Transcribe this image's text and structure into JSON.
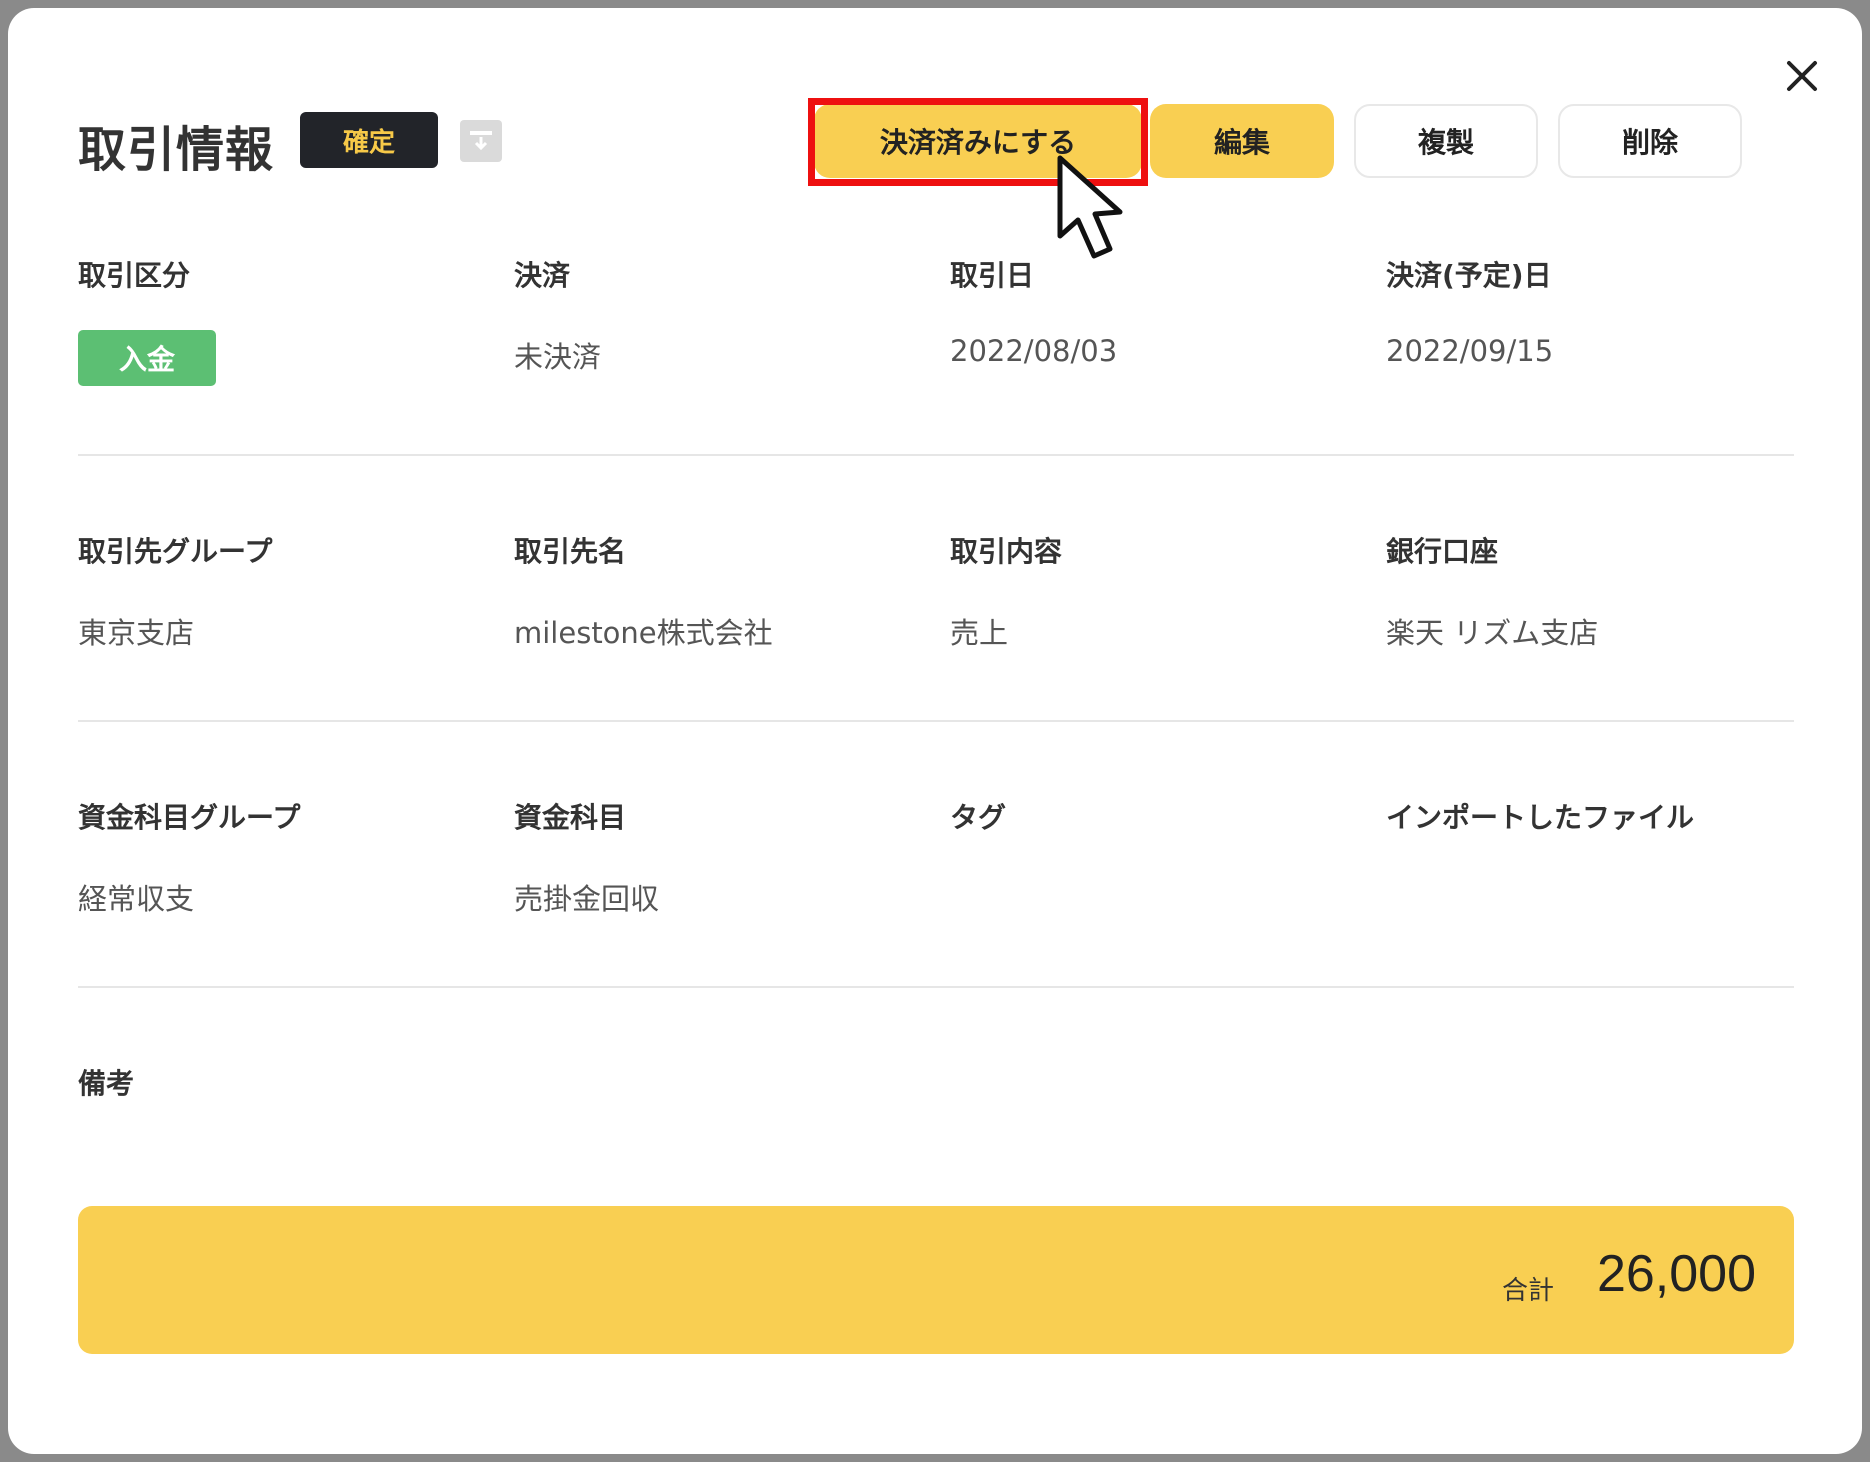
{
  "header": {
    "title": "取引情報",
    "status": "確定",
    "archive_icon": "archive-down-icon",
    "close_icon": "close-icon"
  },
  "actions": {
    "settle": "決済済みにする",
    "edit": "編集",
    "copy": "複製",
    "delete": "削除"
  },
  "sections": [
    {
      "fields": [
        {
          "label": "取引区分",
          "value": "入金"
        },
        {
          "label": "決済",
          "value": "未決済"
        },
        {
          "label": "取引日",
          "value": "2022/08/03"
        },
        {
          "label": "決済(予定)日",
          "value": "2022/09/15"
        }
      ]
    },
    {
      "fields": [
        {
          "label": "取引先グループ",
          "value": "東京支店"
        },
        {
          "label": "取引先名",
          "value": "milestone株式会社"
        },
        {
          "label": "取引内容",
          "value": "売上"
        },
        {
          "label": "銀行口座",
          "value": "楽天 リズム支店"
        }
      ]
    },
    {
      "fields": [
        {
          "label": "資金科目グループ",
          "value": "経常収支"
        },
        {
          "label": "資金科目",
          "value": "売掛金回収"
        },
        {
          "label": "タグ",
          "value": ""
        },
        {
          "label": "インポートしたファイル",
          "value": ""
        }
      ]
    }
  ],
  "notes": {
    "label": "備考",
    "value": ""
  },
  "total": {
    "label": "合計",
    "value": "26,000"
  },
  "colors": {
    "accent_yellow": "#f9cf52",
    "badge_dark": "#222429",
    "badge_text": "#f7c948",
    "deposit_green": "#5cbf73",
    "highlight_red": "#ee1010"
  }
}
